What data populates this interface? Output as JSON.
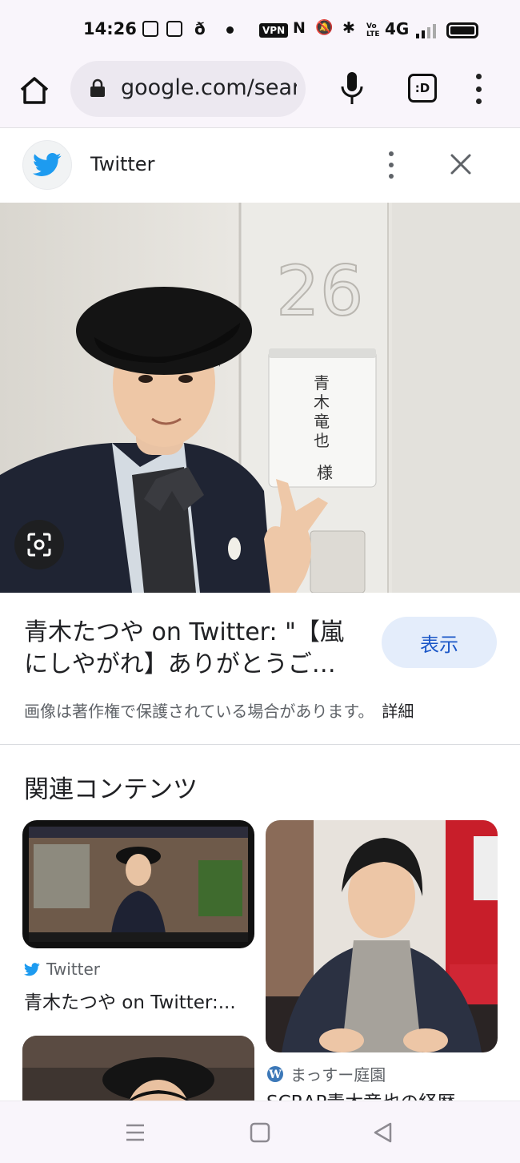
{
  "status_bar": {
    "time": "14:26",
    "vpn": "VPN",
    "network": "4G",
    "volte": "Vo LTE"
  },
  "browser": {
    "url": "google.com/sear",
    "tab_label": ":D"
  },
  "source": {
    "name": "Twitter",
    "icon": "twitter-bird-icon",
    "brand_color": "#1d9bf0"
  },
  "result": {
    "title_line1": "青木たつや on Twitter: \"【嵐",
    "title_line2": "にしやがれ】ありがとうご…",
    "view_button": "表示",
    "copyright_notice": "画像は著作権で保護されている場合があります。",
    "detail_link": "詳細"
  },
  "photo": {
    "door_number": "26",
    "nameplate": "青木竜也",
    "nameplate_suffix": "様"
  },
  "related": {
    "heading": "関連コンテンツ",
    "cards": [
      {
        "source": "Twitter",
        "source_icon": "twitter-bird-icon",
        "title": "青木たつや on Twitter:..."
      },
      {
        "source": "まっすー庭園",
        "source_icon": "wordpress-icon",
        "title": "SCRAP青木竜也の経歴"
      },
      {
        "source": "",
        "source_icon": "",
        "title": ""
      }
    ]
  },
  "nav": {
    "buttons": [
      "menu-icon",
      "home-square-icon",
      "back-triangle-icon"
    ]
  },
  "colors": {
    "accent": "#1a56c7",
    "view_button_bg": "#e4edfb",
    "chrome_bg": "#f9f5fb"
  }
}
